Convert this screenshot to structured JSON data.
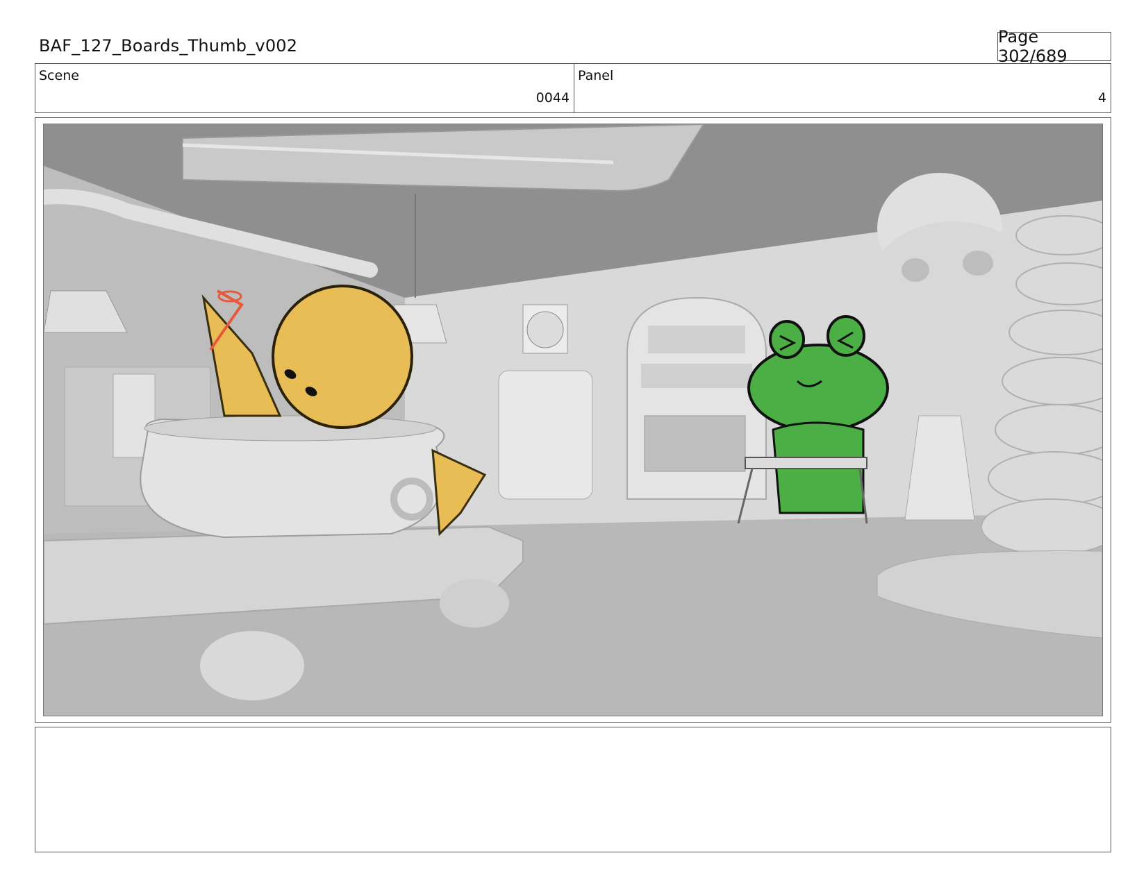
{
  "header": {
    "title": "BAF_127_Boards_Thumb_v002",
    "page": "Page 302/689"
  },
  "info": {
    "scene_label": "Scene",
    "scene_value": "0044",
    "panel_label": "Panel",
    "panel_value": "4"
  },
  "panel_image": {
    "description_icon": "storyboard-frame",
    "characters": [
      "yellow-character-in-cauldron",
      "green-frog-character-at-keyboard"
    ],
    "colors": {
      "background_gray": "#9e9e9e",
      "yellow_character": "#e8bd55",
      "green_character": "#4caf45",
      "red_sketch": "#e8583c"
    }
  },
  "notes": {
    "text": ""
  }
}
